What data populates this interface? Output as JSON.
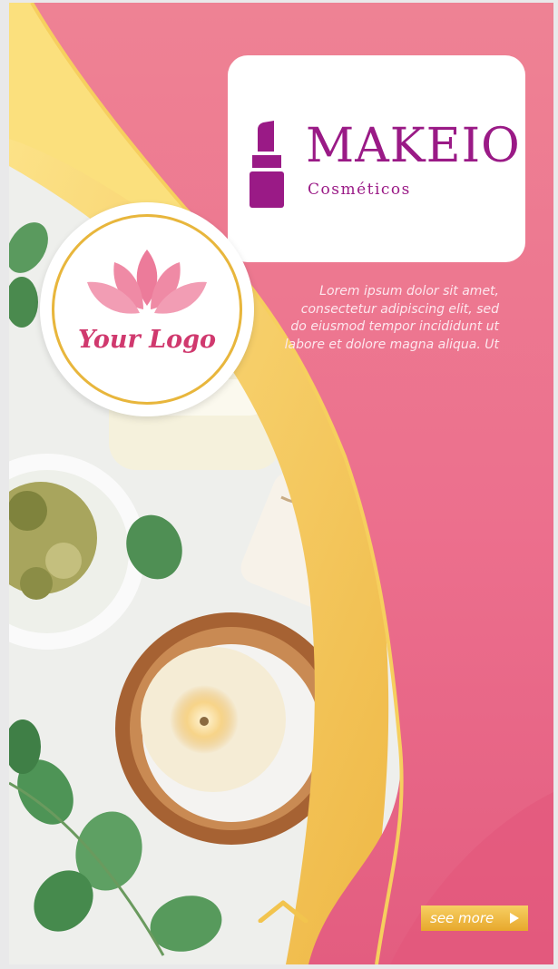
{
  "brand": {
    "name": "MAKEIO",
    "subtitle": "Cosméticos",
    "color": "#9a1a86",
    "icon": "lipstick-icon"
  },
  "logo": {
    "text": "Your Logo",
    "icon": "lotus-icon",
    "color": "#d0396e",
    "ring_color": "#e8b63c"
  },
  "body_text": "Lorem ipsum dolor sit amet, consectetur adipiscing elit, sed do eiusmod tempor incididunt ut labore et dolore magna aliqua. Ut",
  "cta": {
    "label": "see more",
    "icon": "play-triangle-icon"
  },
  "scroll_hint_icon": "chevron-up-icon",
  "colors": {
    "pink": "#ec7b93",
    "gold": "#f2c44e",
    "white": "#ffffff"
  }
}
